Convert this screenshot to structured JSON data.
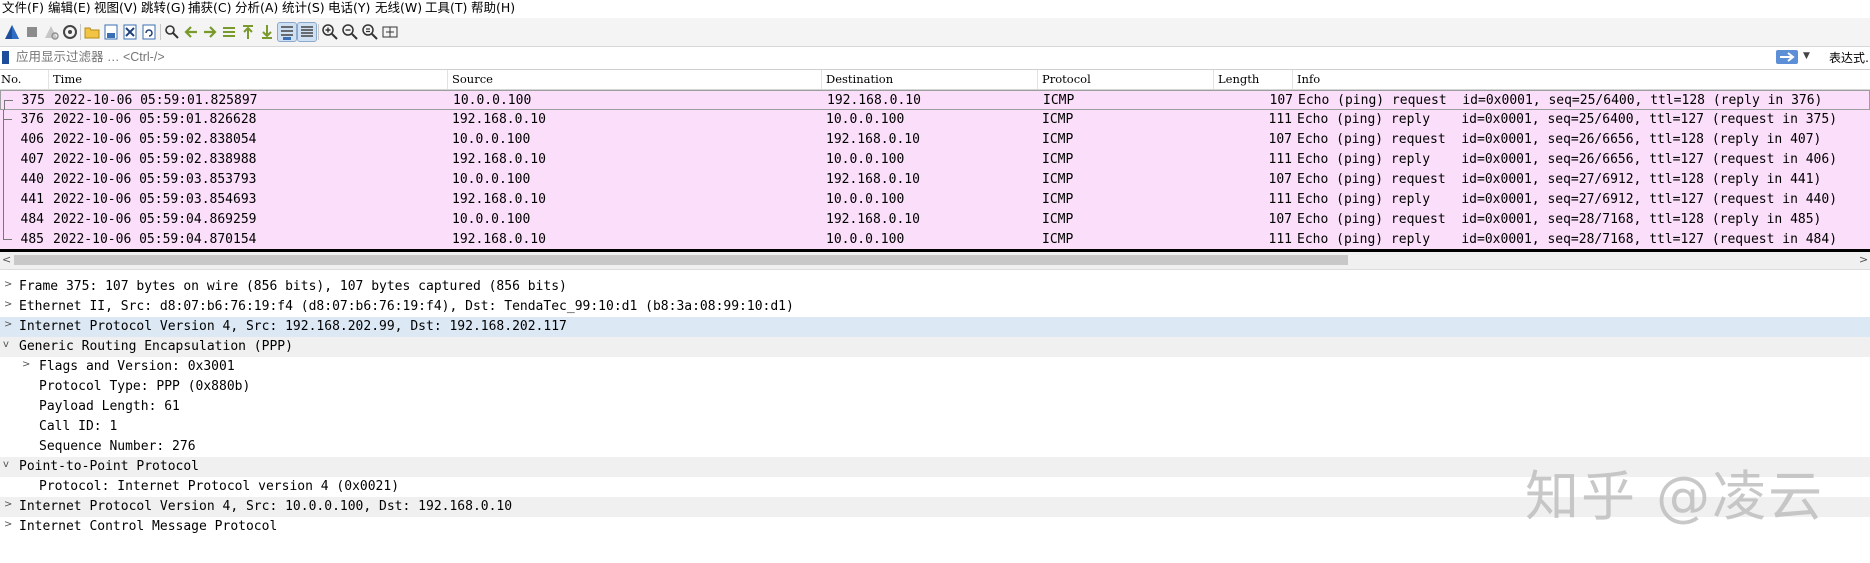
{
  "menu": [
    "文件(F)",
    "编辑(E)",
    "视图(V)",
    "跳转(G)",
    "捕获(C)",
    "分析(A)",
    "统计(S)",
    "电话(Y)",
    "无线(W)",
    "工具(T)",
    "帮助(H)"
  ],
  "filter": {
    "placeholder": "应用显示过滤器 … <Ctrl-/>",
    "expression_label": "表达式…"
  },
  "columns": {
    "no": "No.",
    "time": "Time",
    "source": "Source",
    "destination": "Destination",
    "protocol": "Protocol",
    "length": "Length",
    "info": "Info"
  },
  "packets": [
    {
      "no": "375",
      "time": "2022-10-06 05:59:01.825897",
      "src": "10.0.0.100",
      "dst": "192.168.0.10",
      "proto": "ICMP",
      "len": "107",
      "info": "Echo (ping) request  id=0x0001, seq=25/6400, ttl=128 (reply in 376)"
    },
    {
      "no": "376",
      "time": "2022-10-06 05:59:01.826628",
      "src": "192.168.0.10",
      "dst": "10.0.0.100",
      "proto": "ICMP",
      "len": "111",
      "info": "Echo (ping) reply    id=0x0001, seq=25/6400, ttl=127 (request in 375)"
    },
    {
      "no": "406",
      "time": "2022-10-06 05:59:02.838054",
      "src": "10.0.0.100",
      "dst": "192.168.0.10",
      "proto": "ICMP",
      "len": "107",
      "info": "Echo (ping) request  id=0x0001, seq=26/6656, ttl=128 (reply in 407)"
    },
    {
      "no": "407",
      "time": "2022-10-06 05:59:02.838988",
      "src": "192.168.0.10",
      "dst": "10.0.0.100",
      "proto": "ICMP",
      "len": "111",
      "info": "Echo (ping) reply    id=0x0001, seq=26/6656, ttl=127 (request in 406)"
    },
    {
      "no": "440",
      "time": "2022-10-06 05:59:03.853793",
      "src": "10.0.0.100",
      "dst": "192.168.0.10",
      "proto": "ICMP",
      "len": "107",
      "info": "Echo (ping) request  id=0x0001, seq=27/6912, ttl=128 (reply in 441)"
    },
    {
      "no": "441",
      "time": "2022-10-06 05:59:03.854693",
      "src": "192.168.0.10",
      "dst": "10.0.0.100",
      "proto": "ICMP",
      "len": "111",
      "info": "Echo (ping) reply    id=0x0001, seq=27/6912, ttl=127 (request in 440)"
    },
    {
      "no": "484",
      "time": "2022-10-06 05:59:04.869259",
      "src": "10.0.0.100",
      "dst": "192.168.0.10",
      "proto": "ICMP",
      "len": "107",
      "info": "Echo (ping) request  id=0x0001, seq=28/7168, ttl=128 (reply in 485)"
    },
    {
      "no": "485",
      "time": "2022-10-06 05:59:04.870154",
      "src": "192.168.0.10",
      "dst": "10.0.0.100",
      "proto": "ICMP",
      "len": "111",
      "info": "Echo (ping) reply    id=0x0001, seq=28/7168, ttl=127 (request in 484)"
    }
  ],
  "details": [
    {
      "text": "Frame 375: 107 bytes on wire (856 bits), 107 bytes captured (856 bits)",
      "expanded": false
    },
    {
      "text": "Ethernet II, Src: d8:07:b6:76:19:f4 (d8:07:b6:76:19:f4), Dst: TendaTec_99:10:d1 (b8:3a:08:99:10:d1)",
      "expanded": false
    },
    {
      "text": "Internet Protocol Version 4, Src: 192.168.202.99, Dst: 192.168.202.117",
      "expanded": false
    },
    {
      "text": "Generic Routing Encapsulation (PPP)",
      "expanded": true
    },
    {
      "text": "Flags and Version: 0x3001",
      "expanded": false
    },
    {
      "text": "Protocol Type: PPP (0x880b)"
    },
    {
      "text": "Payload Length: 61"
    },
    {
      "text": "Call ID: 1"
    },
    {
      "text": "Sequence Number: 276"
    },
    {
      "text": "Point-to-Point Protocol",
      "expanded": true
    },
    {
      "text": "Protocol: Internet Protocol version 4 (0x0021)"
    },
    {
      "text": "Internet Protocol Version 4, Src: 10.0.0.100, Dst: 192.168.0.10",
      "expanded": false
    },
    {
      "text": "Internet Control Message Protocol",
      "expanded": false
    }
  ],
  "watermark": "知乎 @凌云",
  "colors": {
    "icmp_row": "#fbdffa",
    "selected_detail": "#dce9f5",
    "shark_fin": "#1e4d9b"
  }
}
